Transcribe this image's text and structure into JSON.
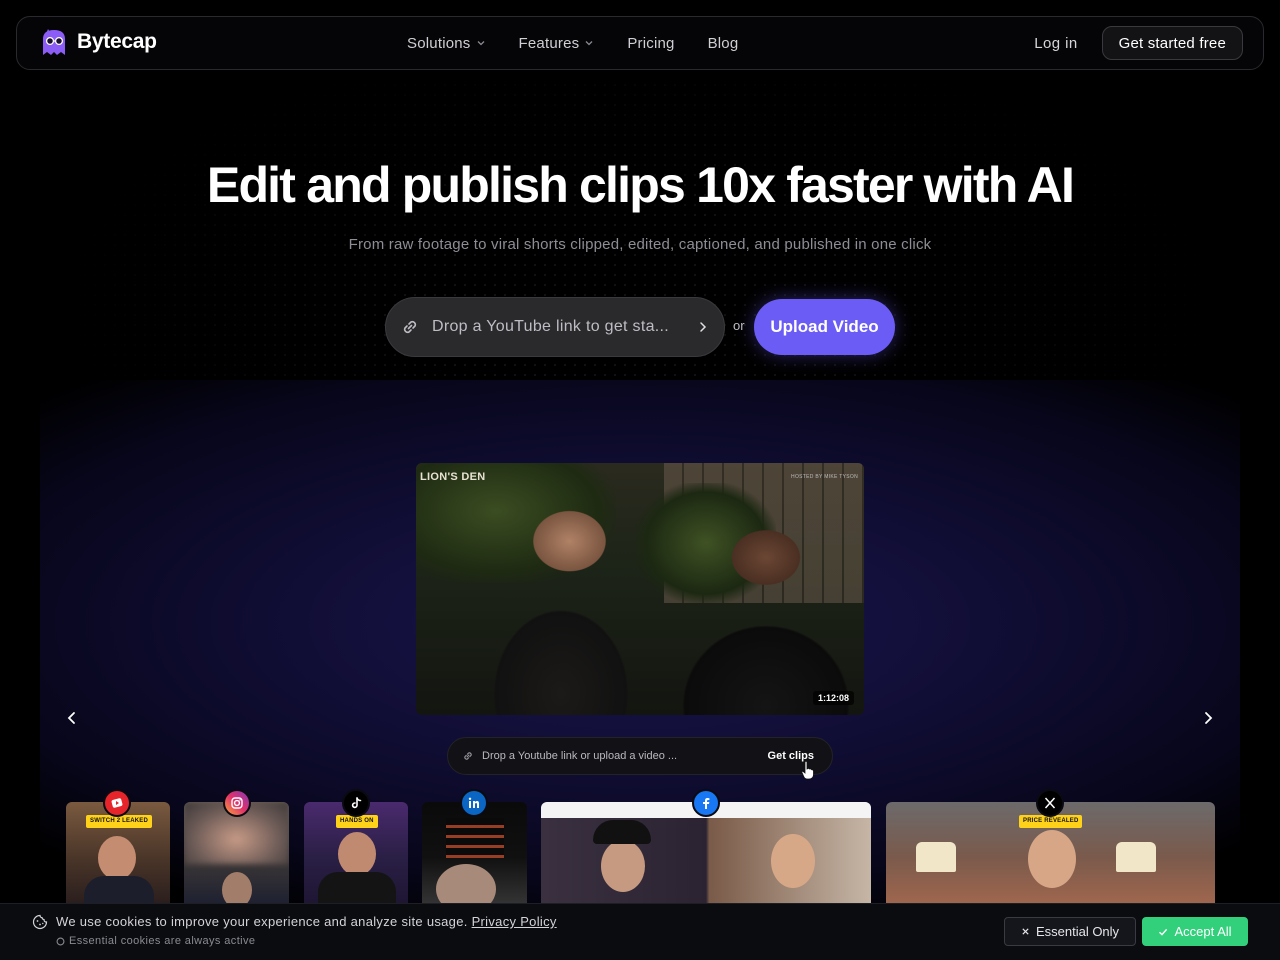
{
  "brand": {
    "name": "Bytecap",
    "logo_icon": "ghost-glasses-icon"
  },
  "nav": {
    "links": [
      {
        "label": "Solutions",
        "has_dropdown": true
      },
      {
        "label": "Features",
        "has_dropdown": true
      },
      {
        "label": "Pricing",
        "has_dropdown": false
      },
      {
        "label": "Blog",
        "has_dropdown": false
      }
    ],
    "login": "Log in",
    "cta": "Get started free"
  },
  "hero": {
    "title": "Edit and publish clips 10x faster with AI",
    "subtitle": "From raw footage to viral shorts clipped, edited, captioned, and published in one click",
    "link_placeholder": "Drop a YouTube link to get sta...",
    "or": "or",
    "upload": "Upload Video"
  },
  "showcase": {
    "video_logo": "LION'S DEN",
    "video_logo_right": "HOSTED BY MIKE TYSON",
    "duration": "1:12:08",
    "mini_placeholder": "Drop a Youtube link or upload a video ...",
    "mini_cta": "Get clips",
    "thumbnails": [
      {
        "platform": "youtube-shorts-icon",
        "badge": "SWITCH 2 LEAKED"
      },
      {
        "platform": "instagram-icon",
        "badge": ""
      },
      {
        "platform": "tiktok-icon",
        "badge": "HANDS ON"
      },
      {
        "platform": "linkedin-icon",
        "badge": ""
      },
      {
        "platform": "facebook-icon",
        "badge": ""
      },
      {
        "platform": "x-icon",
        "badge": "PRICE REVEALED"
      }
    ]
  },
  "cookie": {
    "text": "We use cookies to improve your experience and analyze site usage.",
    "policy_link": "Privacy Policy",
    "note": "Essential cookies are always active",
    "essential": "Essential Only",
    "accept": "Accept All"
  },
  "colors": {
    "accent": "#6b5cf6",
    "accept_green": "#33d07c",
    "badge_yellow": "#ffd21a"
  }
}
